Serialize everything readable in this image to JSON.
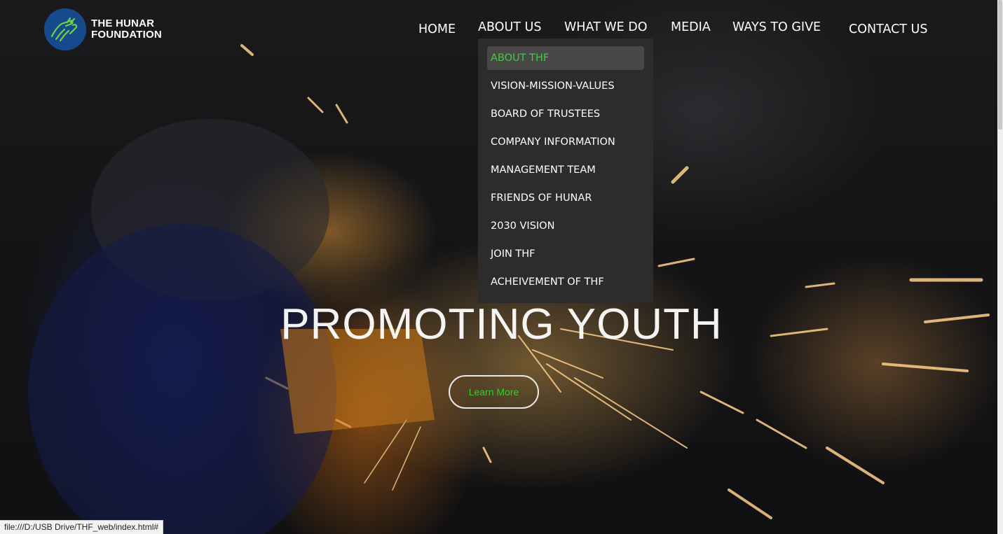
{
  "logo": {
    "line1": "THE HUNAR",
    "line2": "FOUNDATION",
    "icon": "hands-logo-icon",
    "circle_color": "#174a8c",
    "icon_color": "#6fd14a"
  },
  "nav": {
    "items": [
      {
        "label": "HOME"
      },
      {
        "label": "ABOUT US"
      },
      {
        "label": "WHAT WE DO"
      },
      {
        "label": "MEDIA"
      },
      {
        "label": "WAYS TO GIVE"
      },
      {
        "label": "CONTACT US"
      }
    ]
  },
  "dropdown": {
    "items": [
      {
        "label": "ABOUT THF",
        "active": true
      },
      {
        "label": "VISION-MISSION-VALUES"
      },
      {
        "label": "BOARD OF TRUSTEES"
      },
      {
        "label": "COMPANY INFORMATION"
      },
      {
        "label": "MANAGEMENT TEAM"
      },
      {
        "label": "FRIENDS OF HUNAR"
      },
      {
        "label": "2030 VISION"
      },
      {
        "label": "JOIN THF"
      },
      {
        "label": "ACHEIVEMENT OF THF"
      }
    ],
    "active_color": "#3bd13b"
  },
  "hero": {
    "title": "PROMOTING YOUTH",
    "button_label": "Learn More",
    "button_color": "#33cc33"
  },
  "status_bar": {
    "url": "file:///D:/USB Drive/THF_web/index.html#"
  }
}
